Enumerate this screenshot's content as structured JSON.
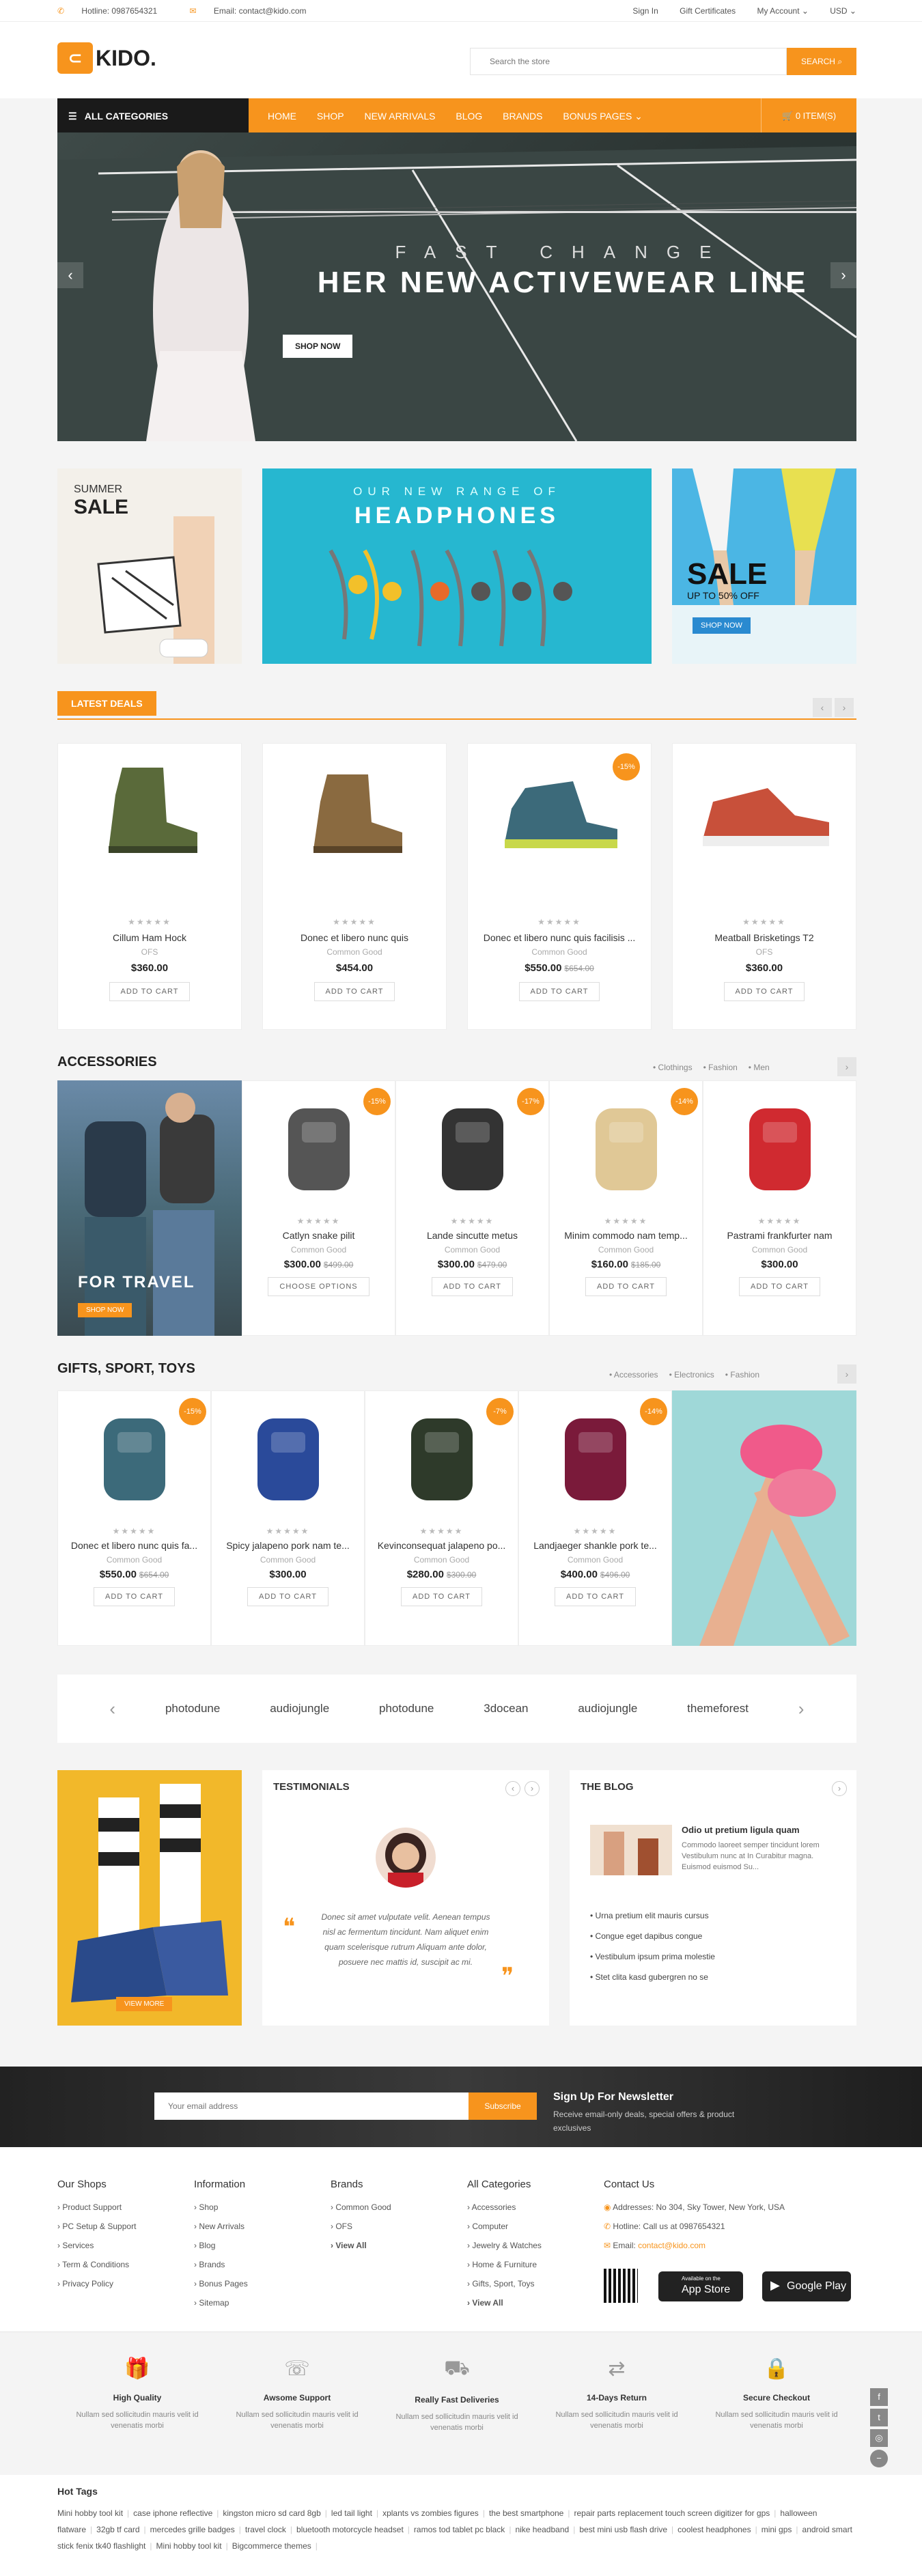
{
  "topbar": {
    "hotline": "Hotline: 0987654321",
    "email": "Email: contact@kido.com",
    "signin": "Sign In",
    "gift": "Gift Certificates",
    "account": "My Account ⌄",
    "currency": "USD ⌄"
  },
  "header": {
    "logo": "KIDO.",
    "search_placeholder": "Search the store",
    "search_label": "SEARCH"
  },
  "nav": {
    "all_categories": "ALL CATEGORIES",
    "items": [
      "HOME",
      "SHOP",
      "NEW ARRIVALS",
      "BLOG",
      "BRANDS",
      "BONUS PAGES  ⌄"
    ],
    "cart": "0 ITEM(S)"
  },
  "hero": {
    "kicker": "FAST CHANGE",
    "title": "HER NEW ACTIVEWEAR LINE",
    "button": "SHOP NOW"
  },
  "banners": {
    "b1_small": "SUMMER",
    "b1_big": "SALE",
    "b2_small": "OUR NEW RANGE OF",
    "b2_big": "HEADPHONES",
    "b3_big": "SALE",
    "b3_small": "UP TO 50% OFF",
    "b3_btn": "SHOP NOW"
  },
  "latest": {
    "title": "LATEST DEALS",
    "products": [
      {
        "name": "Cillum Ham Hock",
        "brand": "OFS",
        "price": "$360.00",
        "old": "",
        "badge": "",
        "btn": "ADD TO CART",
        "color": "#5a6a3a"
      },
      {
        "name": "Donec et libero nunc quis",
        "brand": "Common Good",
        "price": "$454.00",
        "old": "",
        "badge": "",
        "btn": "ADD TO CART",
        "color": "#8a6a40"
      },
      {
        "name": "Donec et libero nunc quis facilisis ...",
        "brand": "Common Good",
        "price": "$550.00",
        "old": "$654.00",
        "badge": "-15%",
        "btn": "ADD TO CART",
        "color": "#3c6a7a"
      },
      {
        "name": "Meatball Brisketings T2",
        "brand": "OFS",
        "price": "$360.00",
        "old": "",
        "badge": "",
        "btn": "ADD TO CART",
        "color": "#c8503a"
      }
    ]
  },
  "accessories": {
    "title": "ACCESSORIES",
    "tags": [
      "• Clothings",
      "• Fashion",
      "• Men"
    ],
    "promo": "FOR TRAVEL",
    "promo_btn": "SHOP NOW",
    "products": [
      {
        "name": "Catlyn snake pilit",
        "brand": "Common Good",
        "price": "$300.00",
        "old": "$499.00",
        "badge": "-15%",
        "btn": "CHOOSE OPTIONS",
        "color": "#555"
      },
      {
        "name": "Lande sincutte metus",
        "brand": "Common Good",
        "price": "$300.00",
        "old": "$479.00",
        "badge": "-17%",
        "btn": "ADD TO CART",
        "color": "#333"
      },
      {
        "name": "Minim commodo nam temp...",
        "brand": "Common Good",
        "price": "$160.00",
        "old": "$185.00",
        "badge": "-14%",
        "btn": "ADD TO CART",
        "color": "#e0c896"
      },
      {
        "name": "Pastrami frankfurter nam",
        "brand": "Common Good",
        "price": "$300.00",
        "old": "",
        "badge": "",
        "btn": "ADD TO CART",
        "color": "#d02a30"
      }
    ]
  },
  "gifts": {
    "title": "GIFTS, SPORT, TOYS",
    "tags": [
      "• Accessories",
      "• Electronics",
      "• Fashion"
    ],
    "products": [
      {
        "name": "Donec et libero nunc quis fa...",
        "brand": "Common Good",
        "price": "$550.00",
        "old": "$654.00",
        "badge": "-15%",
        "btn": "ADD TO CART",
        "color": "#3c6a7a"
      },
      {
        "name": "Spicy jalapeno pork nam te...",
        "brand": "Common Good",
        "price": "$300.00",
        "old": "",
        "badge": "",
        "btn": "ADD TO CART",
        "color": "#2a4a9a"
      },
      {
        "name": "Kevinconsequat jalapeno po...",
        "brand": "Common Good",
        "price": "$280.00",
        "old": "$300.00",
        "badge": "-7%",
        "btn": "ADD TO CART",
        "color": "#2e3a2a"
      },
      {
        "name": "Landjaeger shankle pork te...",
        "brand": "Common Good",
        "price": "$400.00",
        "old": "$496.00",
        "badge": "-14%",
        "btn": "ADD TO CART",
        "color": "#7a1a3a"
      }
    ]
  },
  "brands": [
    "photodune",
    "audiojungle",
    "photodune",
    "3docean",
    "audiojungle",
    "themeforest"
  ],
  "promo_left": {
    "button": "VIEW MORE"
  },
  "testimonials": {
    "title": "TESTIMONIALS",
    "quote": "Donec sit amet vulputate velit. Aenean tempus nisl ac fermentum tincidunt. Nam aliquet enim quam scelerisque rutrum Aliquam ante dolor, posuere nec mattis id, suscipit ac mi."
  },
  "blog": {
    "title": "THE BLOG",
    "post_title": "Odio ut pretium ligula quam",
    "post_text": "Commodo laoreet semper tincidunt lorem Vestibulum nunc at In Curabitur magna. Euismod euismod Su...",
    "items": [
      "Urna pretium elit mauris cursus",
      "Congue eget dapibus congue",
      "Vestibulum ipsum prima molestie",
      "Stet clita kasd gubergren no se"
    ]
  },
  "newsletter": {
    "placeholder": "Your email address",
    "button": "Subscribe",
    "title": "Sign Up For Newsletter",
    "text": "Receive email-only deals, special offers & product exclusives"
  },
  "footer": {
    "our_shops": {
      "title": "Our Shops",
      "items": [
        "Product Support",
        "PC Setup & Support",
        "Services",
        "Term & Conditions",
        "Privacy Policy"
      ]
    },
    "information": {
      "title": "Information",
      "items": [
        "Shop",
        "New Arrivals",
        "Blog",
        "Brands",
        "Bonus Pages",
        "Sitemap"
      ]
    },
    "brands": {
      "title": "Brands",
      "items": [
        "Common Good",
        "OFS",
        "View All"
      ]
    },
    "categories": {
      "title": "All Categories",
      "items": [
        "Accessories",
        "Computer",
        "Jewelry & Watches",
        "Home & Furniture",
        "Gifts, Sport, Toys",
        "View All"
      ]
    },
    "contact": {
      "title": "Contact Us",
      "address": "Addresses: No 304, Sky Tower, New York, USA",
      "hotline": "Hotline: Call us at 0987654321",
      "email_label": "Email:",
      "email": "contact@kido.com",
      "appstore": "App Store",
      "appstore_small": "Available on the",
      "googleplay": "Google Play"
    }
  },
  "features": [
    {
      "title": "High Quality",
      "text": "Nullam sed sollicitudin mauris velit id venenatis morbi",
      "icon": "gift-icon"
    },
    {
      "title": "Awsome Support",
      "text": "Nullam sed sollicitudin mauris velit id venenatis morbi",
      "icon": "phone-icon"
    },
    {
      "title": "Really Fast Deliveries",
      "text": "Nullam sed sollicitudin mauris velit id venenatis morbi",
      "icon": "truck-icon"
    },
    {
      "title": "14-Days Return",
      "text": "Nullam sed sollicitudin mauris velit id venenatis morbi",
      "icon": "arrows-icon"
    },
    {
      "title": "Secure Checkout",
      "text": "Nullam sed sollicitudin mauris velit id venenatis morbi",
      "icon": "lock-icon"
    }
  ],
  "hot_tags": {
    "title": "Hot Tags",
    "tags": [
      "Mini hobby tool kit",
      "case iphone reflective",
      "kingston micro sd card 8gb",
      "led tail light",
      "xplants vs zombies figures",
      "the best smartphone",
      "repair parts replacement touch screen digitizer for gps",
      "halloween flatware",
      "32gb tf card",
      "mercedes grille badges",
      "travel clock",
      "bluetooth motorcycle headset",
      "ramos tod tablet pc black",
      "nike headband",
      "best mini usb flash drive",
      "coolest headphones",
      "mini gps",
      "android smart stick fenix tk40 flashlight",
      "Mini hobby tool kit",
      "Bigcommerce themes"
    ]
  },
  "colors": {
    "accent": "#f7941d",
    "dark": "#1a1a1a"
  }
}
